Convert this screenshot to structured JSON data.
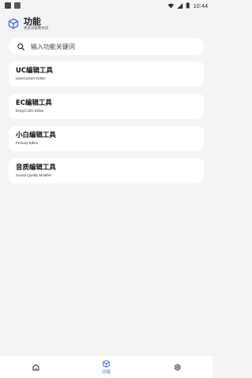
{
  "status_bar": {
    "time": "10:44"
  },
  "header": {
    "title": "功能",
    "subtitle": "更多功能要你说"
  },
  "search": {
    "placeholder": "输入功能关键词"
  },
  "cards": [
    {
      "title": "UC编辑工具",
      "subtitle": "UserCustom Editor"
    },
    {
      "title": "EC编辑工具",
      "subtitle": "EnjoyCJZC Editor"
    },
    {
      "title": "小白编辑工具",
      "subtitle": "Primary Editor"
    },
    {
      "title": "音质编辑工具",
      "subtitle": "Sound Quality Modifier"
    }
  ],
  "bottom_nav": {
    "items": [
      {
        "icon": "home-icon",
        "label": ""
      },
      {
        "icon": "cube-icon",
        "label": "功能",
        "active": true
      },
      {
        "icon": "gear-icon",
        "label": ""
      }
    ],
    "accent": "#4a6cf7"
  }
}
